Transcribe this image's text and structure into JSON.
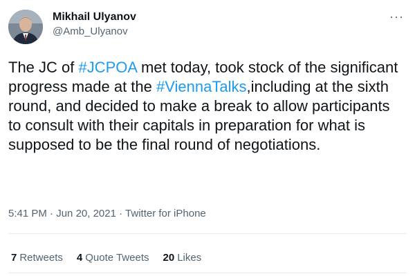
{
  "author": {
    "display_name": "Mikhail Ulyanov",
    "handle": "@Amb_Ulyanov",
    "avatar_icon": "profile-photo"
  },
  "menu_icon": "ellipsis",
  "tweet": {
    "text_part1": "The JC of ",
    "hashtag1": "#JCPOA",
    "text_part2": " met today, took stock of the significant progress made at the ",
    "hashtag2": "#ViennaTalks",
    "text_part3": ",including at the sixth round, and decided to make a break to allow participants to consult with their capitals in preparation for what is supposed to be the final round of negotiations."
  },
  "meta": {
    "time": "5:41 PM",
    "date": "Jun 20, 2021",
    "source": "Twitter for iPhone",
    "separator": "·"
  },
  "stats": {
    "retweets_count": "7",
    "retweets_label": "Retweets",
    "quote_count": "4",
    "quote_label": "Quote Tweets",
    "likes_count": "20",
    "likes_label": "Likes"
  },
  "colors": {
    "hashtag": "#1d9bf0",
    "secondary_text": "#536471",
    "primary_text": "#0f1419"
  }
}
